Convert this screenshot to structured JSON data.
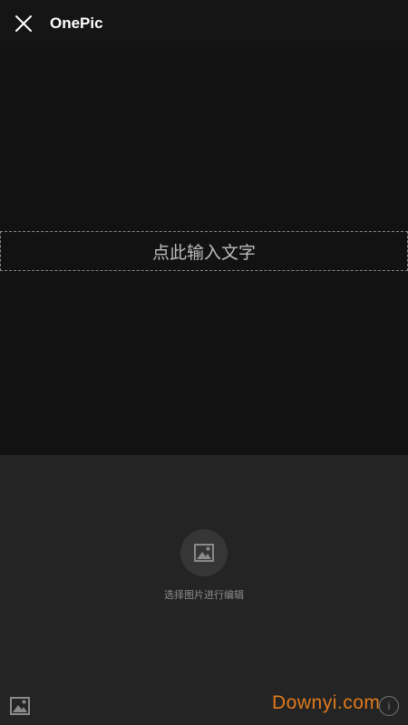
{
  "header": {
    "title": "OnePic",
    "close_icon": "close-icon"
  },
  "canvas": {
    "text_placeholder": "点此输入文字"
  },
  "bottom_panel": {
    "pick_image_icon": "image-icon",
    "pick_image_label": "选择图片进行编辑",
    "gallery_icon": "gallery-icon",
    "info_icon": "info-icon",
    "info_glyph": "i"
  },
  "watermark": {
    "text": "Downyi.com"
  },
  "colors": {
    "canvas_bg": "#121212",
    "panel_bg": "#242424",
    "watermark": "#e07a1c"
  }
}
